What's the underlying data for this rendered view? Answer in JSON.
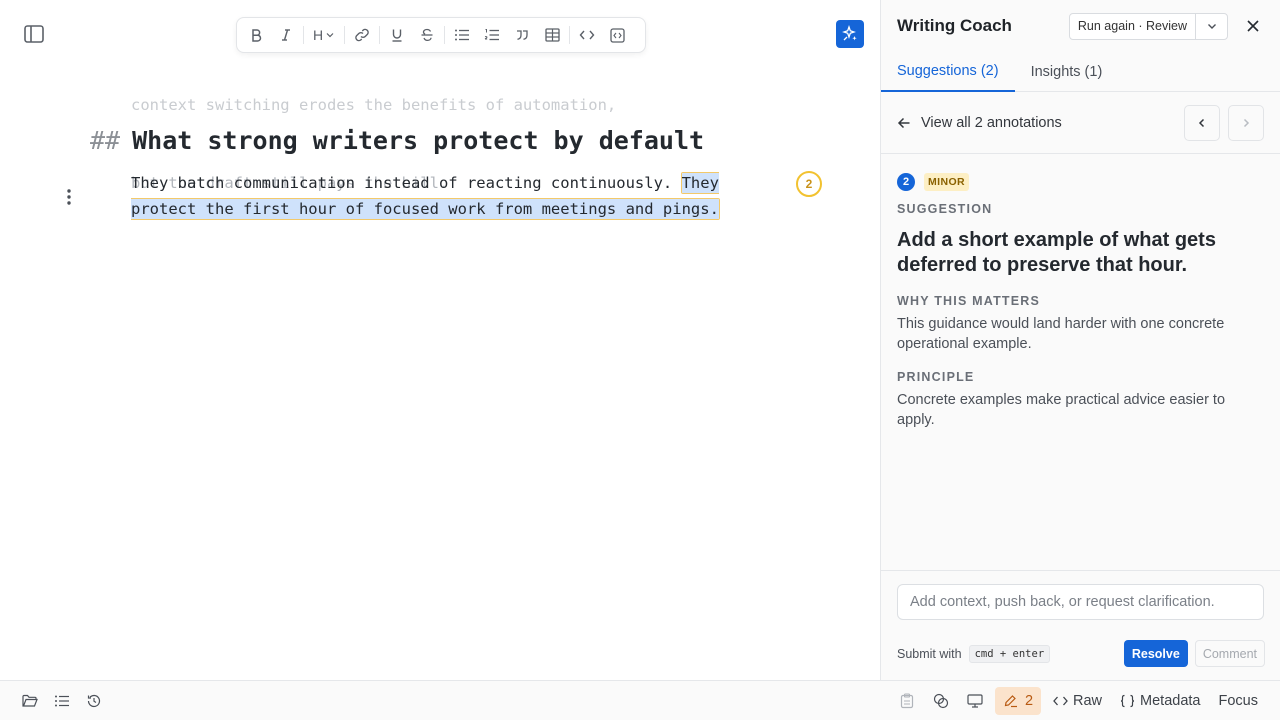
{
  "editor": {
    "toolbar": {
      "buttons": [
        "bold-icon",
        "italic-icon",
        "heading-icon",
        "link-icon",
        "underline-icon",
        "strikethrough-icon",
        "bullet-list-icon",
        "numbered-list-icon",
        "quote-icon",
        "table-icon",
        "code-icon",
        "code-block-icon"
      ],
      "heading_label": "H"
    },
    "faded_line_1": "context switching erodes the benefits of automation,",
    "faded_line_2": "but the draft still pays the bill.",
    "heading_marker": "##",
    "heading_text": "What strong writers protect by default",
    "paragraph_plain": "They batch communication instead of reacting continuously. ",
    "paragraph_highlighted": "They protect the first hour of focused work from meetings and pings.",
    "annotation_marker": "2"
  },
  "panel": {
    "title": "Writing Coach",
    "run_button": "Run again · Review",
    "tabs": [
      {
        "label": "Suggestions (2)",
        "active": true
      },
      {
        "label": "Insights (1)",
        "active": false
      }
    ],
    "back_link": "View all 2 annotations",
    "annotation": {
      "number": "2",
      "severity": "MINOR",
      "type_label": "SUGGESTION",
      "suggestion": "Add a short example of what gets deferred to preserve that hour.",
      "why_label": "WHY THIS MATTERS",
      "why_text": "This guidance would land harder with one concrete operational example.",
      "principle_label": "PRINCIPLE",
      "principle_text": "Concrete examples make practical advice easier to apply."
    },
    "composer": {
      "placeholder": "Add context, push back, or request clarification.",
      "submit_hint": "Submit with",
      "shortcut": "cmd + enter",
      "resolve": "Resolve",
      "comment": "Comment"
    }
  },
  "statusbar": {
    "annotations_count": "2",
    "raw": "Raw",
    "metadata": "Metadata",
    "focus": "Focus"
  },
  "colors": {
    "accent": "#1565d8",
    "highlight": "#cfe2fb",
    "marker": "#f2c230",
    "severity_bg": "#fdefc4"
  }
}
